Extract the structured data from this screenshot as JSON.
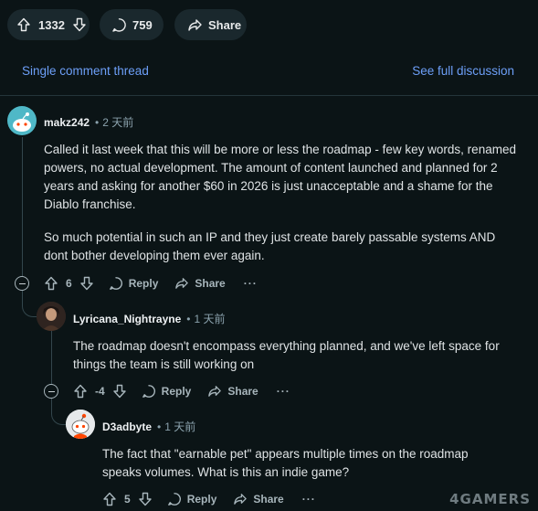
{
  "post_bar": {
    "vote_count": "1332",
    "comment_count": "759",
    "share_label": "Share"
  },
  "thread_nav": {
    "single_thread_label": "Single comment thread",
    "full_discussion_label": "See full discussion"
  },
  "comments": [
    {
      "author": "makz242",
      "time": "2 天前",
      "paragraphs": [
        "Called it last week that this will be more or less the roadmap - few key words, renamed powers, no actual development. The amount of content launched and planned for 2 years and asking for another $60 in 2026 is just unacceptable and a shame for the Diablo franchise.",
        "So much potential in such an IP and they just create barely passable systems AND dont bother developing them ever again."
      ],
      "score": "6",
      "reply_label": "Reply",
      "share_label": "Share",
      "more_label": "···"
    },
    {
      "author": "Lyricana_Nightrayne",
      "time": "1 天前",
      "paragraphs": [
        "The roadmap doesn't encompass everything planned, and we've left space for things the team is still working on"
      ],
      "score": "-4",
      "reply_label": "Reply",
      "share_label": "Share",
      "more_label": "···"
    },
    {
      "author": "D3adbyte",
      "time": "1 天前",
      "paragraphs": [
        "The fact that \"earnable pet\" appears multiple times on the roadmap speaks volumes. What is this an indie game?"
      ],
      "score": "5",
      "reply_label": "Reply",
      "share_label": "Share",
      "more_label": "···"
    }
  ],
  "watermark": "4GAMERS",
  "colors": {
    "background": "#0b1416",
    "pill": "#1a282d",
    "link": "#6d9ff8",
    "muted": "#8ba2ad",
    "thread_line": "#33464c"
  }
}
